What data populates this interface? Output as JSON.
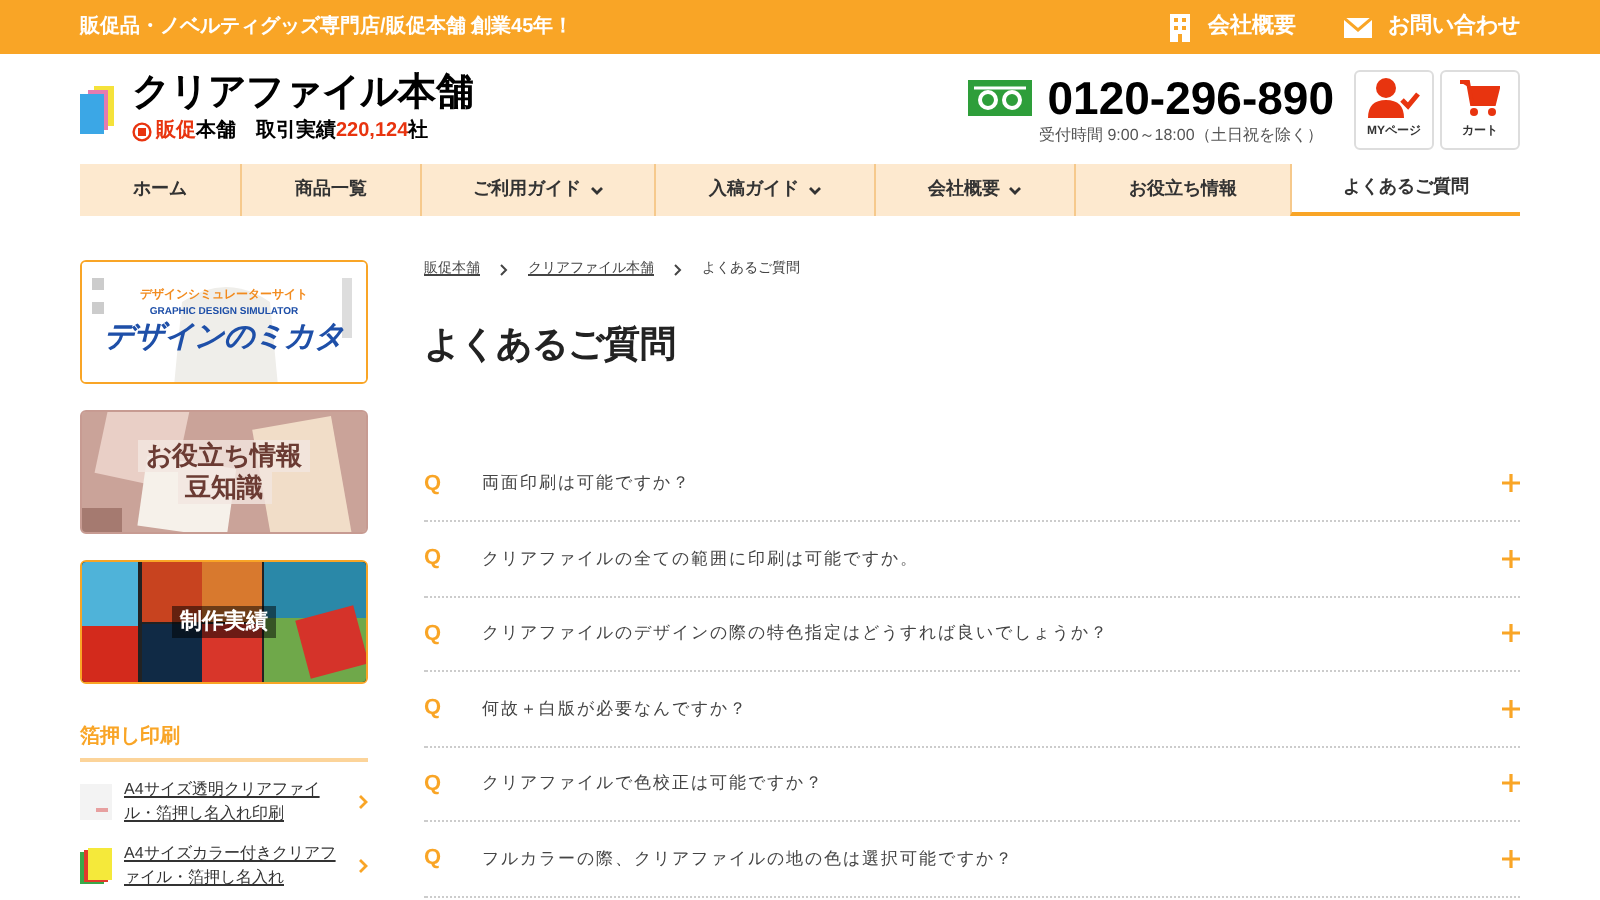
{
  "top_bar": {
    "tagline": "販促品・ノベルティグッズ専門店/販促本舗 創業45年！",
    "links": [
      {
        "label": "会社概要"
      },
      {
        "label": "お問い合わせ"
      }
    ]
  },
  "header": {
    "title": "クリアファイル本舗",
    "brand_prefix": "販促",
    "brand": "本舗",
    "record_label": "取引実績",
    "record_count": "220,124",
    "record_unit": "社",
    "phone": "0120-296-890",
    "hours": "受付時間 9:00～18:00（土日祝を除く）",
    "buttons": [
      {
        "label": "MYページ"
      },
      {
        "label": "カート"
      }
    ]
  },
  "nav": [
    {
      "label": "ホーム",
      "dropdown": false,
      "selected": false
    },
    {
      "label": "商品一覧",
      "dropdown": false,
      "selected": false
    },
    {
      "label": "ご利用ガイド",
      "dropdown": true,
      "selected": false
    },
    {
      "label": "入稿ガイド",
      "dropdown": true,
      "selected": false
    },
    {
      "label": "会社概要",
      "dropdown": true,
      "selected": false
    },
    {
      "label": "お役立ち情報",
      "dropdown": false,
      "selected": false
    },
    {
      "label": "よくあるご質問",
      "dropdown": false,
      "selected": true
    }
  ],
  "sidebar": {
    "banners": [
      {
        "kind": "simulator",
        "lines": [
          "デザインシミュレーターサイト",
          "GRAPHIC DESIGN SIMULATOR",
          "デザインのミカタ"
        ]
      },
      {
        "kind": "tips",
        "lines": [
          "お役立ち情報",
          "豆知識"
        ]
      },
      {
        "kind": "works",
        "lines": [
          "制作実績"
        ]
      }
    ],
    "section_title": "箔押し印刷",
    "items": [
      {
        "label": "A4サイズ透明クリアファイル・箔押し名入れ印刷"
      },
      {
        "label": "A4サイズカラー付きクリアファイル・箔押し名入れ"
      }
    ]
  },
  "breadcrumb": [
    {
      "label": "販促本舗",
      "link": true
    },
    {
      "label": "クリアファイル本舗",
      "link": true
    },
    {
      "label": "よくあるご質問",
      "link": false
    }
  ],
  "page_title": "よくあるご質問",
  "faq": [
    {
      "marker": "Q",
      "question": "両面印刷は可能ですか？",
      "expanded": false
    },
    {
      "marker": "Q",
      "question": "クリアファイルの全ての範囲に印刷は可能ですか。",
      "expanded": false
    },
    {
      "marker": "Q",
      "question": "クリアファイルのデザインの際の特色指定はどうすれば良いでしょうか？",
      "expanded": false
    },
    {
      "marker": "Q",
      "question": "何故＋白版が必要なんですか？",
      "expanded": false
    },
    {
      "marker": "Q",
      "question": "クリアファイルで色校正は可能ですか？",
      "expanded": false
    },
    {
      "marker": "Q",
      "question": "フルカラーの際、クリアファイルの地の色は選択可能ですか？",
      "expanded": false
    }
  ]
}
